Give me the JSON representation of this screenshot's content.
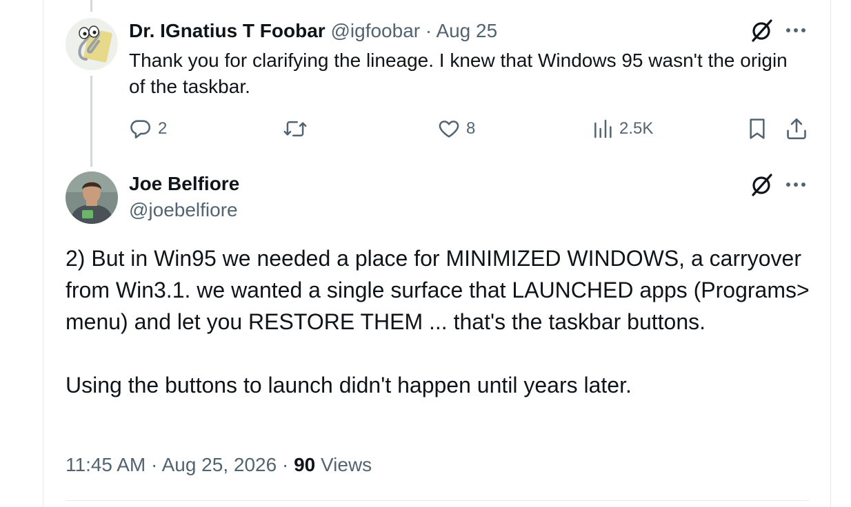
{
  "reply": {
    "author_name": "Dr. IGnatius T Foobar",
    "handle": "@igfoobar",
    "separator": " · ",
    "date": "Aug 25",
    "text": "Thank you for clarifying the lineage. I knew that Windows 95 wasn't the origin of the taskbar.",
    "actions": {
      "replies": "2",
      "retweets": "",
      "likes": "8",
      "views": "2.5K"
    },
    "icons": [
      "grok-icon",
      "more-icon",
      "reply-icon",
      "retweet-icon",
      "like-icon",
      "views-icon",
      "bookmark-icon",
      "share-icon"
    ]
  },
  "main": {
    "author_name": "Joe Belfiore",
    "handle": "@joebelfiore",
    "paragraphs": [
      "2) But in Win95 we needed a place for MINIMIZED WINDOWS, a carryover from Win3.1.  we wanted a single surface that LAUNCHED apps (Programs> menu) and let you RESTORE THEM ... that's the taskbar buttons.",
      "Using the buttons to launch didn't happen until years later."
    ],
    "time": "11:45 AM",
    "separator": " · ",
    "date": "Aug 25, 2026",
    "views_count": "90",
    "views_label": "Views"
  },
  "colors": {
    "text": "#0f1419",
    "muted": "#536471",
    "thread_line": "#cfd9de",
    "border": "#e6e9ec"
  }
}
